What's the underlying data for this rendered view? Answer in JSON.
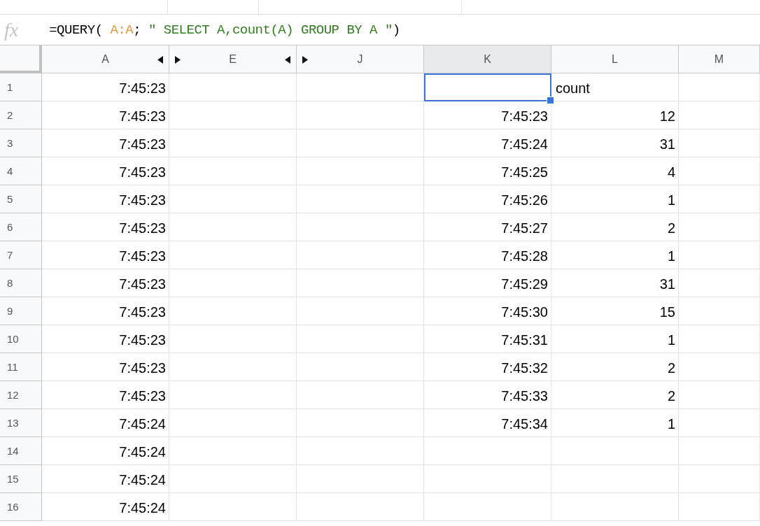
{
  "formula_bar": {
    "label": "fx",
    "segments": [
      {
        "kind": "plain",
        "text": "=QUERY( "
      },
      {
        "kind": "range",
        "text": "A:A"
      },
      {
        "kind": "plain",
        "text": "; "
      },
      {
        "kind": "string",
        "text": "\" SELECT A,count(A) GROUP BY A \""
      },
      {
        "kind": "plain",
        "text": ")"
      }
    ]
  },
  "columns": [
    {
      "label": "A",
      "selected": false,
      "collapsed_after": true
    },
    {
      "label": "E",
      "selected": false,
      "collapsed_after": true
    },
    {
      "label": "J",
      "selected": false,
      "collapsed_after": false
    },
    {
      "label": "K",
      "selected": true,
      "collapsed_after": false
    },
    {
      "label": "L",
      "selected": false,
      "collapsed_after": false
    },
    {
      "label": "M",
      "selected": false,
      "collapsed_after": false
    }
  ],
  "rows": [
    {
      "number": "1",
      "cells": [
        {
          "kind": "number",
          "text": "7:45:23"
        },
        {
          "kind": "empty"
        },
        {
          "kind": "empty"
        },
        {
          "kind": "active"
        },
        {
          "kind": "text",
          "text": "count"
        },
        {
          "kind": "empty"
        }
      ]
    },
    {
      "number": "2",
      "cells": [
        {
          "kind": "number",
          "text": "7:45:23"
        },
        {
          "kind": "empty"
        },
        {
          "kind": "empty"
        },
        {
          "kind": "number",
          "text": "7:45:23"
        },
        {
          "kind": "number",
          "text": "12"
        },
        {
          "kind": "empty"
        }
      ]
    },
    {
      "number": "3",
      "cells": [
        {
          "kind": "number",
          "text": "7:45:23"
        },
        {
          "kind": "empty"
        },
        {
          "kind": "empty"
        },
        {
          "kind": "number",
          "text": "7:45:24"
        },
        {
          "kind": "number",
          "text": "31"
        },
        {
          "kind": "empty"
        }
      ]
    },
    {
      "number": "4",
      "cells": [
        {
          "kind": "number",
          "text": "7:45:23"
        },
        {
          "kind": "empty"
        },
        {
          "kind": "empty"
        },
        {
          "kind": "number",
          "text": "7:45:25"
        },
        {
          "kind": "number",
          "text": "4"
        },
        {
          "kind": "empty"
        }
      ]
    },
    {
      "number": "5",
      "cells": [
        {
          "kind": "number",
          "text": "7:45:23"
        },
        {
          "kind": "empty"
        },
        {
          "kind": "empty"
        },
        {
          "kind": "number",
          "text": "7:45:26"
        },
        {
          "kind": "number",
          "text": "1"
        },
        {
          "kind": "empty"
        }
      ]
    },
    {
      "number": "6",
      "cells": [
        {
          "kind": "number",
          "text": "7:45:23"
        },
        {
          "kind": "empty"
        },
        {
          "kind": "empty"
        },
        {
          "kind": "number",
          "text": "7:45:27"
        },
        {
          "kind": "number",
          "text": "2"
        },
        {
          "kind": "empty"
        }
      ]
    },
    {
      "number": "7",
      "cells": [
        {
          "kind": "number",
          "text": "7:45:23"
        },
        {
          "kind": "empty"
        },
        {
          "kind": "empty"
        },
        {
          "kind": "number",
          "text": "7:45:28"
        },
        {
          "kind": "number",
          "text": "1"
        },
        {
          "kind": "empty"
        }
      ]
    },
    {
      "number": "8",
      "cells": [
        {
          "kind": "number",
          "text": "7:45:23"
        },
        {
          "kind": "empty"
        },
        {
          "kind": "empty"
        },
        {
          "kind": "number",
          "text": "7:45:29"
        },
        {
          "kind": "number",
          "text": "31"
        },
        {
          "kind": "empty"
        }
      ]
    },
    {
      "number": "9",
      "cells": [
        {
          "kind": "number",
          "text": "7:45:23"
        },
        {
          "kind": "empty"
        },
        {
          "kind": "empty"
        },
        {
          "kind": "number",
          "text": "7:45:30"
        },
        {
          "kind": "number",
          "text": "15"
        },
        {
          "kind": "empty"
        }
      ]
    },
    {
      "number": "10",
      "cells": [
        {
          "kind": "number",
          "text": "7:45:23"
        },
        {
          "kind": "empty"
        },
        {
          "kind": "empty"
        },
        {
          "kind": "number",
          "text": "7:45:31"
        },
        {
          "kind": "number",
          "text": "1"
        },
        {
          "kind": "empty"
        }
      ]
    },
    {
      "number": "11",
      "cells": [
        {
          "kind": "number",
          "text": "7:45:23"
        },
        {
          "kind": "empty"
        },
        {
          "kind": "empty"
        },
        {
          "kind": "number",
          "text": "7:45:32"
        },
        {
          "kind": "number",
          "text": "2"
        },
        {
          "kind": "empty"
        }
      ]
    },
    {
      "number": "12",
      "cells": [
        {
          "kind": "number",
          "text": "7:45:23"
        },
        {
          "kind": "empty"
        },
        {
          "kind": "empty"
        },
        {
          "kind": "number",
          "text": "7:45:33"
        },
        {
          "kind": "number",
          "text": "2"
        },
        {
          "kind": "empty"
        }
      ]
    },
    {
      "number": "13",
      "cells": [
        {
          "kind": "number",
          "text": "7:45:24"
        },
        {
          "kind": "empty"
        },
        {
          "kind": "empty"
        },
        {
          "kind": "number",
          "text": "7:45:34"
        },
        {
          "kind": "number",
          "text": "1"
        },
        {
          "kind": "empty"
        }
      ]
    },
    {
      "number": "14",
      "cells": [
        {
          "kind": "number",
          "text": "7:45:24"
        },
        {
          "kind": "empty"
        },
        {
          "kind": "empty"
        },
        {
          "kind": "empty"
        },
        {
          "kind": "empty"
        },
        {
          "kind": "empty"
        }
      ]
    },
    {
      "number": "15",
      "cells": [
        {
          "kind": "number",
          "text": "7:45:24"
        },
        {
          "kind": "empty"
        },
        {
          "kind": "empty"
        },
        {
          "kind": "empty"
        },
        {
          "kind": "empty"
        },
        {
          "kind": "empty"
        }
      ]
    },
    {
      "number": "16",
      "cells": [
        {
          "kind": "number",
          "text": "7:45:24"
        },
        {
          "kind": "empty"
        },
        {
          "kind": "empty"
        },
        {
          "kind": "empty"
        },
        {
          "kind": "empty"
        },
        {
          "kind": "empty"
        }
      ]
    }
  ]
}
